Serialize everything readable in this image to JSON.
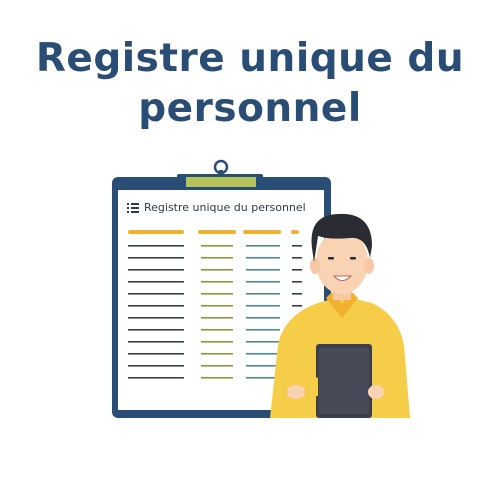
{
  "header": {
    "title_line1": "Registre unique du",
    "title_line2": "personnel"
  },
  "document": {
    "heading": "Registre unique du personnel",
    "heading_icon": "list-icon"
  },
  "colors": {
    "title": "#2a4d75",
    "clipboard": "#2a4d75",
    "clip": "#b5c35a",
    "column_header": "#f0b12e",
    "shirt": "#f6cd48"
  }
}
